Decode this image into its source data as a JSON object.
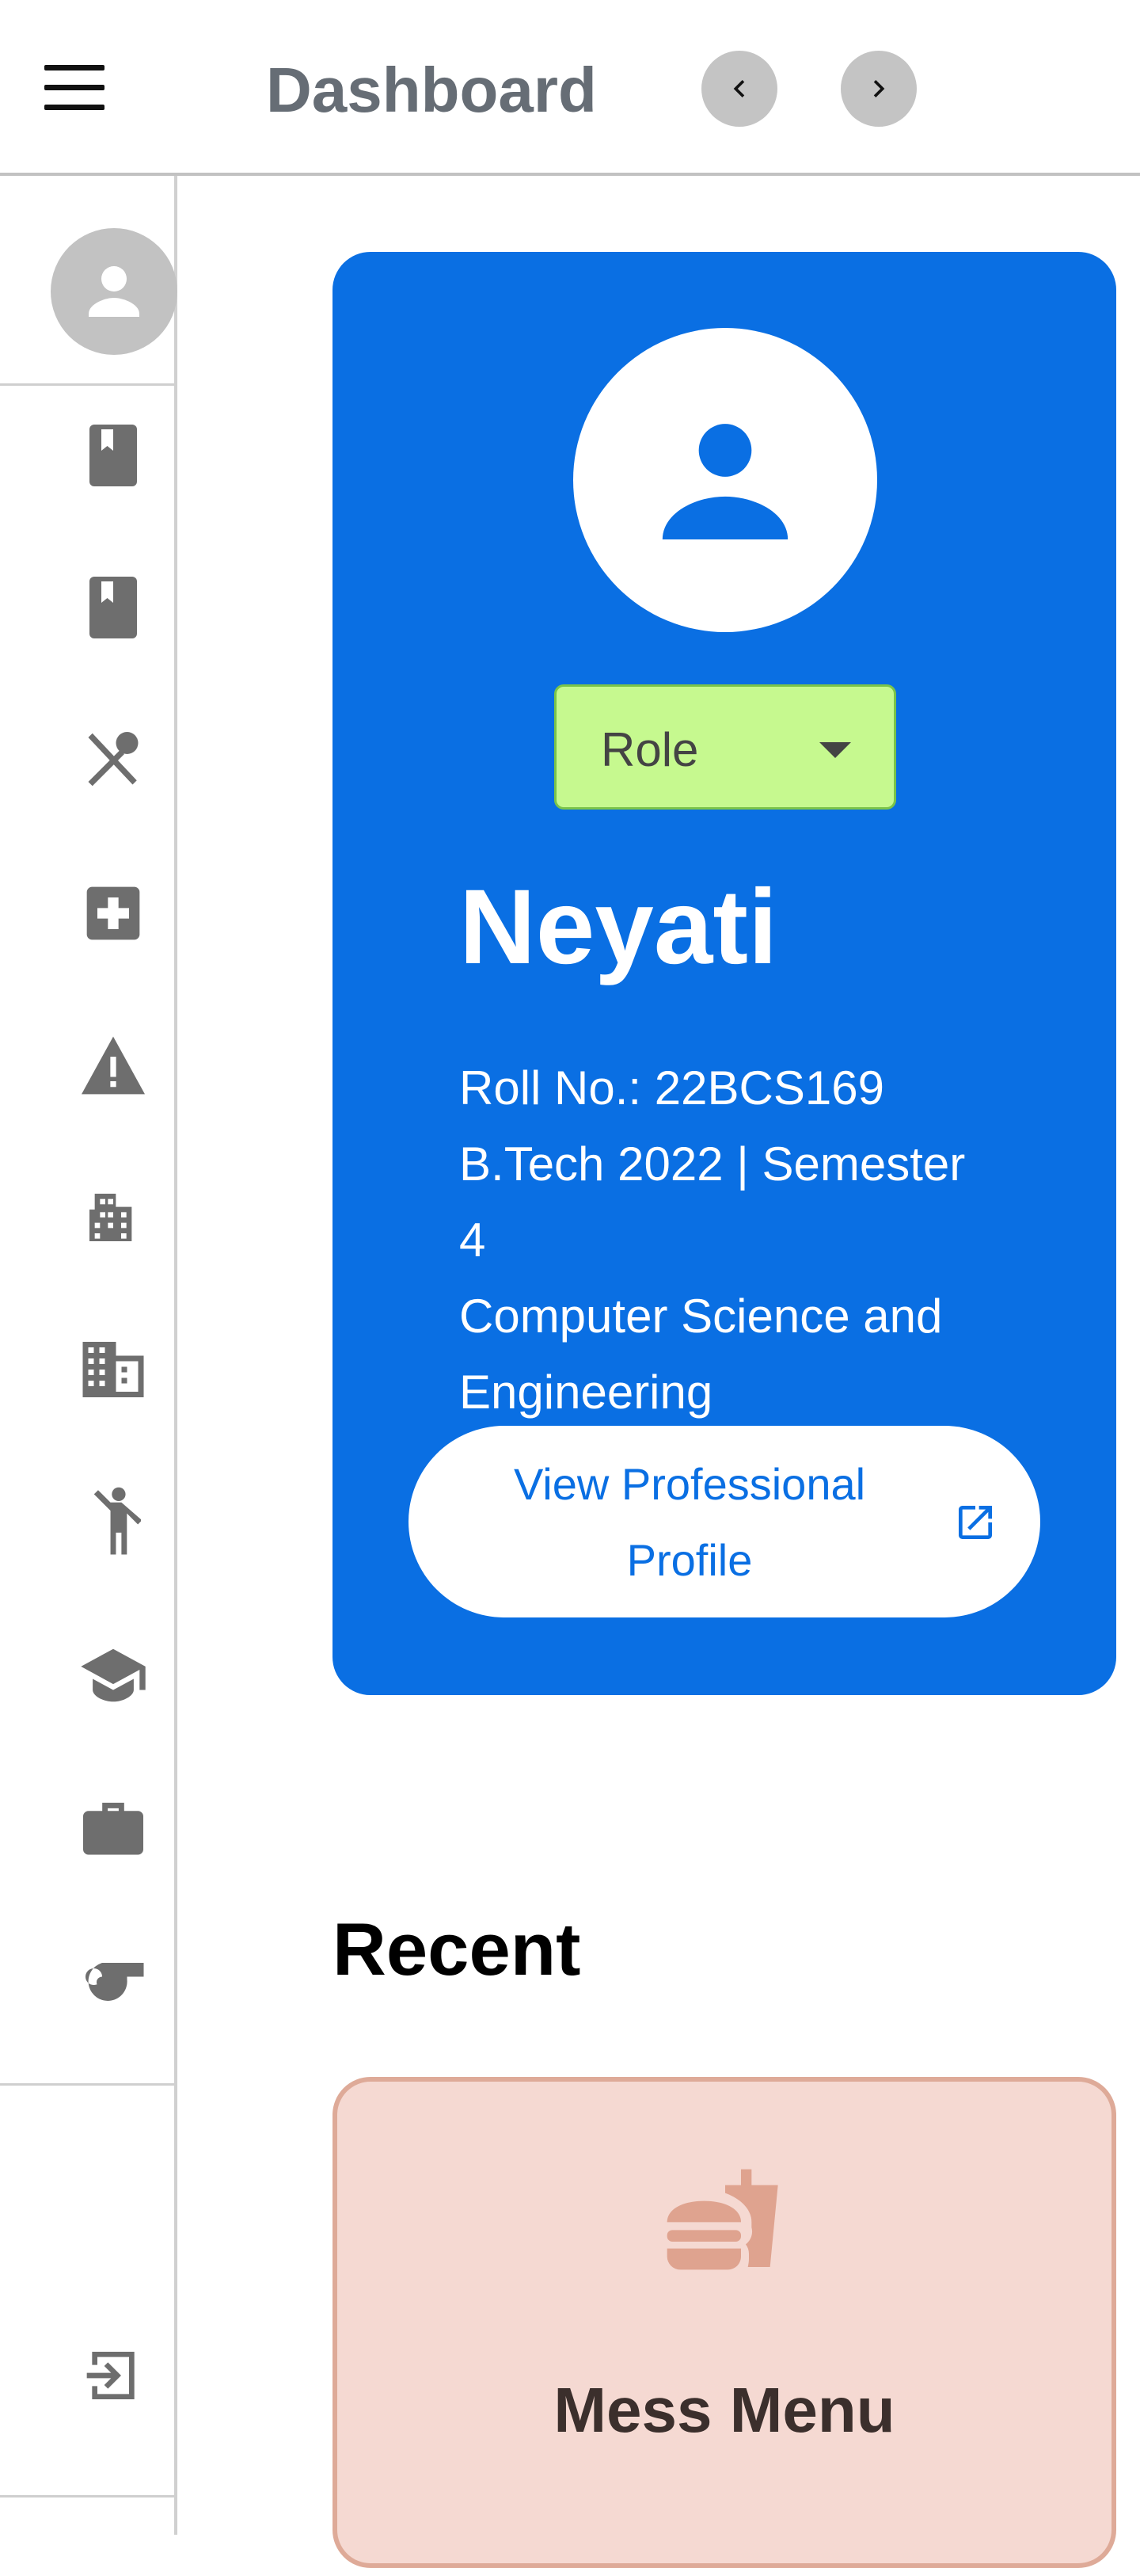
{
  "header": {
    "title": "Dashboard",
    "menu_icon": "hamburger-menu-icon",
    "back_icon": "chevron-left-icon",
    "forward_icon": "chevron-right-icon"
  },
  "sidebar": {
    "avatar_icon": "person-icon",
    "items": [
      {
        "icon": "book-icon"
      },
      {
        "icon": "book-icon"
      },
      {
        "icon": "restaurant-icon"
      },
      {
        "icon": "medical-cross-icon"
      },
      {
        "icon": "warning-icon"
      },
      {
        "icon": "apartment-icon"
      },
      {
        "icon": "domain-icon"
      },
      {
        "icon": "sports-person-icon"
      },
      {
        "icon": "graduation-cap-icon"
      },
      {
        "icon": "briefcase-icon"
      },
      {
        "icon": "whistle-icon"
      }
    ],
    "logout_icon": "login-icon"
  },
  "profile": {
    "role_label": "Role",
    "name": "Neyati",
    "roll": "Roll No.: 22BCS169",
    "program_line1": "B.Tech 2022 | Semester",
    "program_line2": "4",
    "dept_line1": "Computer Science and",
    "dept_line2": "Engineering",
    "button_label": "View Professional Profile",
    "button_icon": "open-in-new-icon"
  },
  "recent": {
    "title": "Recent",
    "tiles": [
      {
        "label": "Mess Menu",
        "icon": "fastfood-icon"
      }
    ]
  },
  "colors": {
    "card_blue": "#0a6fe3",
    "role_green": "#c6f98f",
    "tile_bg": "#f5d9d2",
    "tile_border": "#deaa98",
    "icon_gray": "#6e6e6e"
  }
}
